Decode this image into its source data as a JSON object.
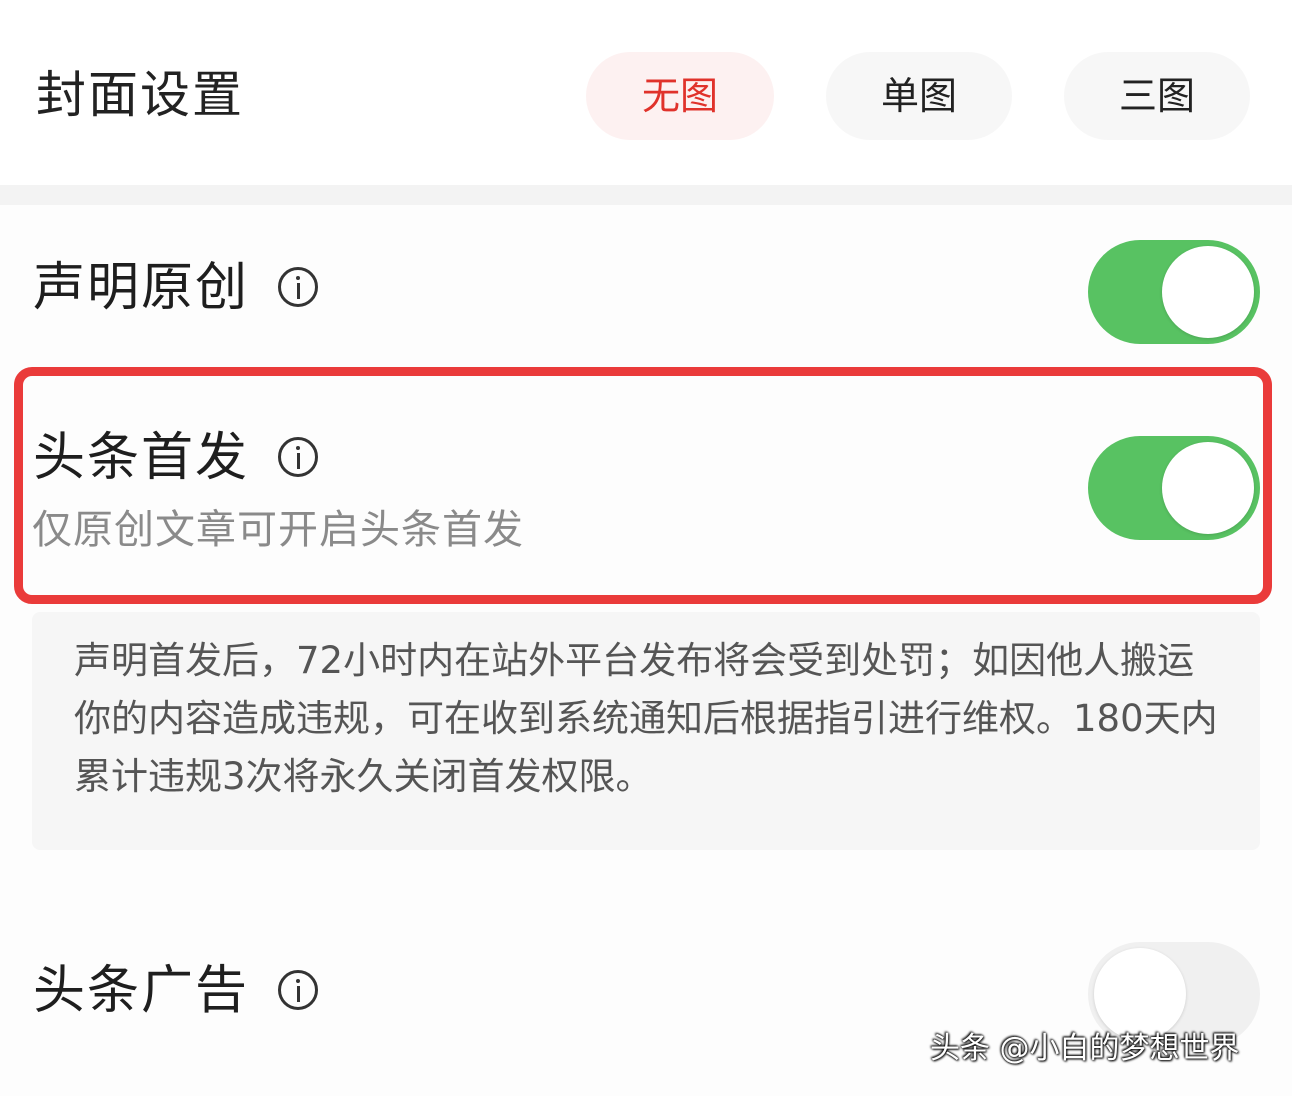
{
  "cover": {
    "title": "封面设置",
    "options": [
      "无图",
      "单图",
      "三图"
    ],
    "selected": "无图",
    "accent_color": "#e0322b"
  },
  "settings": {
    "original": {
      "label": "声明原创",
      "icon": "info-icon",
      "enabled": true
    },
    "first_publish": {
      "label": "头条首发",
      "icon": "info-icon",
      "sub_label": "仅原创文章可开启头条首发",
      "enabled": true,
      "notice": "声明首发后，72小时内在站外平台发布将会受到处罚；如因他人搬运你的内容造成违规，可在收到系统通知后根据指引进行维权。180天内累计违规3次将永久关闭首发权限。"
    },
    "ads": {
      "label": "头条广告",
      "icon": "info-icon",
      "enabled": false
    }
  },
  "colors": {
    "toggle_on": "#58c262",
    "toggle_off": "#f0f0f0",
    "highlight": "#ea3b3a"
  },
  "watermark": "头条 @小白的梦想世界"
}
